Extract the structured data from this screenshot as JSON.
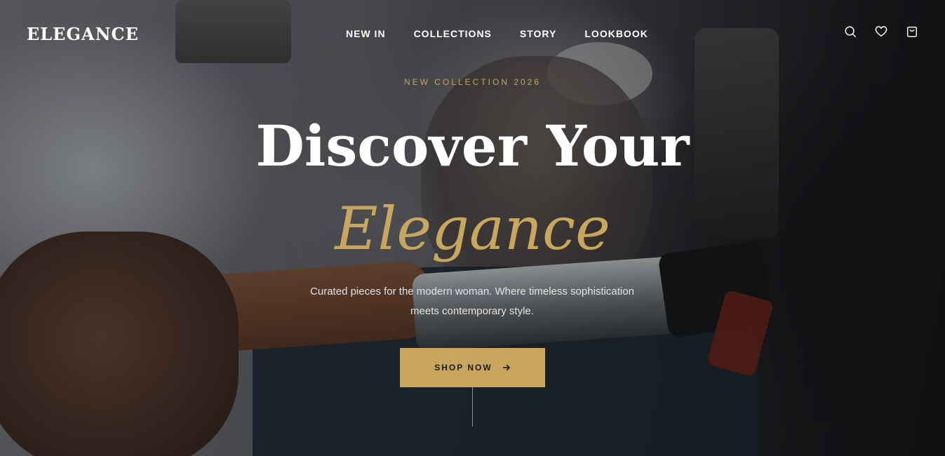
{
  "brand": {
    "logo": "ELEGANCE"
  },
  "nav": {
    "items": [
      {
        "label": "NEW IN"
      },
      {
        "label": "COLLECTIONS"
      },
      {
        "label": "STORY"
      },
      {
        "label": "LOOKBOOK"
      }
    ]
  },
  "header_icons": [
    "search-icon",
    "heart-icon",
    "bag-icon"
  ],
  "hero": {
    "eyebrow": "NEW COLLECTION 2026",
    "title_line1": "Discover Your",
    "title_line2": "Elegance",
    "subtitle": "Curated pieces for the modern woman. Where timeless sophistication meets contemporary style.",
    "cta_label": "SHOP NOW"
  },
  "colors": {
    "accent": "#c9a65f",
    "text": "#ffffff"
  }
}
